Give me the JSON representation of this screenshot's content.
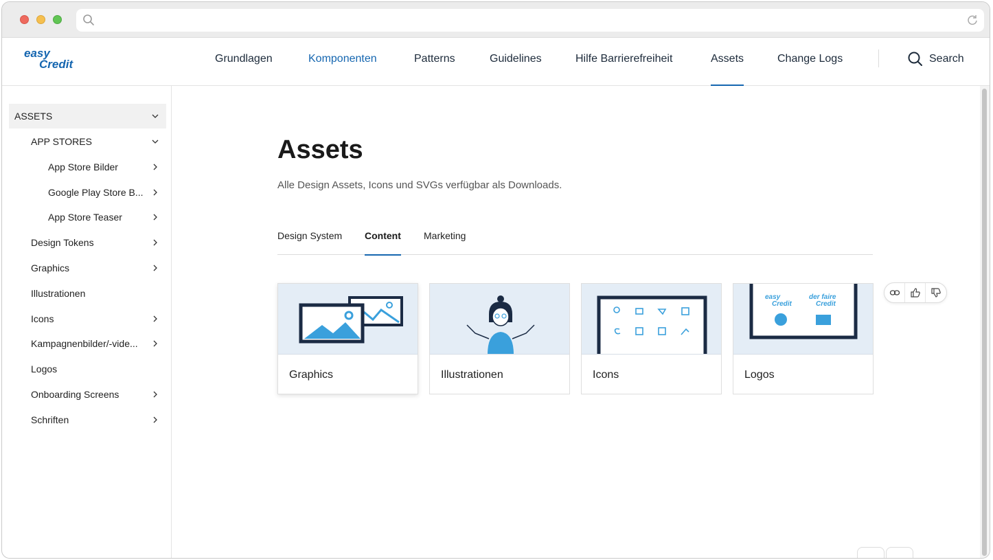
{
  "browser": {
    "icons": {
      "search": "search-icon",
      "reload": "reload-icon"
    }
  },
  "brand": {
    "logo_line1": "easy",
    "logo_line2": "Credit",
    "color_primary": "#1566b0",
    "color_dark": "#1c2a3a"
  },
  "nav": {
    "items": [
      {
        "label": "Grundlagen"
      },
      {
        "label": "Komponenten"
      },
      {
        "label": "Patterns"
      },
      {
        "label": "Guidelines"
      },
      {
        "label": "Hilfe Barrierefreiheit"
      },
      {
        "label": "Assets"
      },
      {
        "label": "Change Logs"
      }
    ],
    "active": "Assets",
    "search_label": "Search"
  },
  "sidebar": {
    "items": [
      {
        "label": "ASSETS",
        "chevron": "down",
        "selected": true
      },
      {
        "label": "APP STORES",
        "chevron": "down"
      },
      {
        "label": "App Store Bilder",
        "chevron": "right"
      },
      {
        "label": "Google Play Store B...",
        "chevron": "right"
      },
      {
        "label": "App Store Teaser",
        "chevron": "right"
      },
      {
        "label": "Design Tokens",
        "chevron": "right"
      },
      {
        "label": "Graphics",
        "chevron": "right"
      },
      {
        "label": "Illustrationen",
        "chevron": "none"
      },
      {
        "label": "Icons",
        "chevron": "right"
      },
      {
        "label": "Kampagnenbilder/-vide...",
        "chevron": "right"
      },
      {
        "label": "Logos",
        "chevron": "none"
      },
      {
        "label": "Onboarding Screens",
        "chevron": "right"
      },
      {
        "label": "Schriften",
        "chevron": "right"
      }
    ]
  },
  "main": {
    "title": "Assets",
    "subtitle": "Alle Design Assets, Icons und SVGs verfügbar als Downloads.",
    "tabs": [
      {
        "label": "Design System"
      },
      {
        "label": "Content",
        "active": true
      },
      {
        "label": "Marketing"
      }
    ],
    "cards": [
      {
        "label": "Graphics"
      },
      {
        "label": "Illustrationen"
      },
      {
        "label": "Icons"
      },
      {
        "label": "Logos"
      }
    ],
    "logo_card": {
      "logo1_line1": "easy",
      "logo1_line2": "Credit",
      "logo2_line1": "der faire",
      "logo2_line2": "Credit"
    },
    "feedback_icons": [
      "link-icon",
      "thumbs-up-icon",
      "thumbs-down-icon"
    ]
  }
}
